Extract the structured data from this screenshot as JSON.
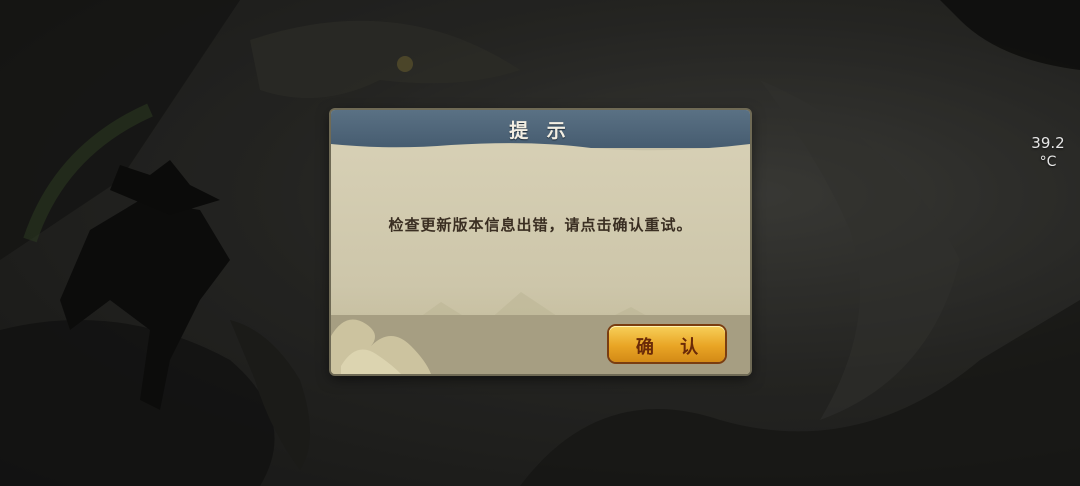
{
  "status": {
    "temperature_value": "39.2",
    "temperature_unit": "°C"
  },
  "dialog": {
    "title": "提 示",
    "message": "检查更新版本信息出错，请点击确认重试。",
    "confirm_label": "确 认"
  },
  "colors": {
    "header": "#4f6679",
    "parchment": "#d2cbaf",
    "button": "#e9a525",
    "button_text": "#6a2a08"
  }
}
